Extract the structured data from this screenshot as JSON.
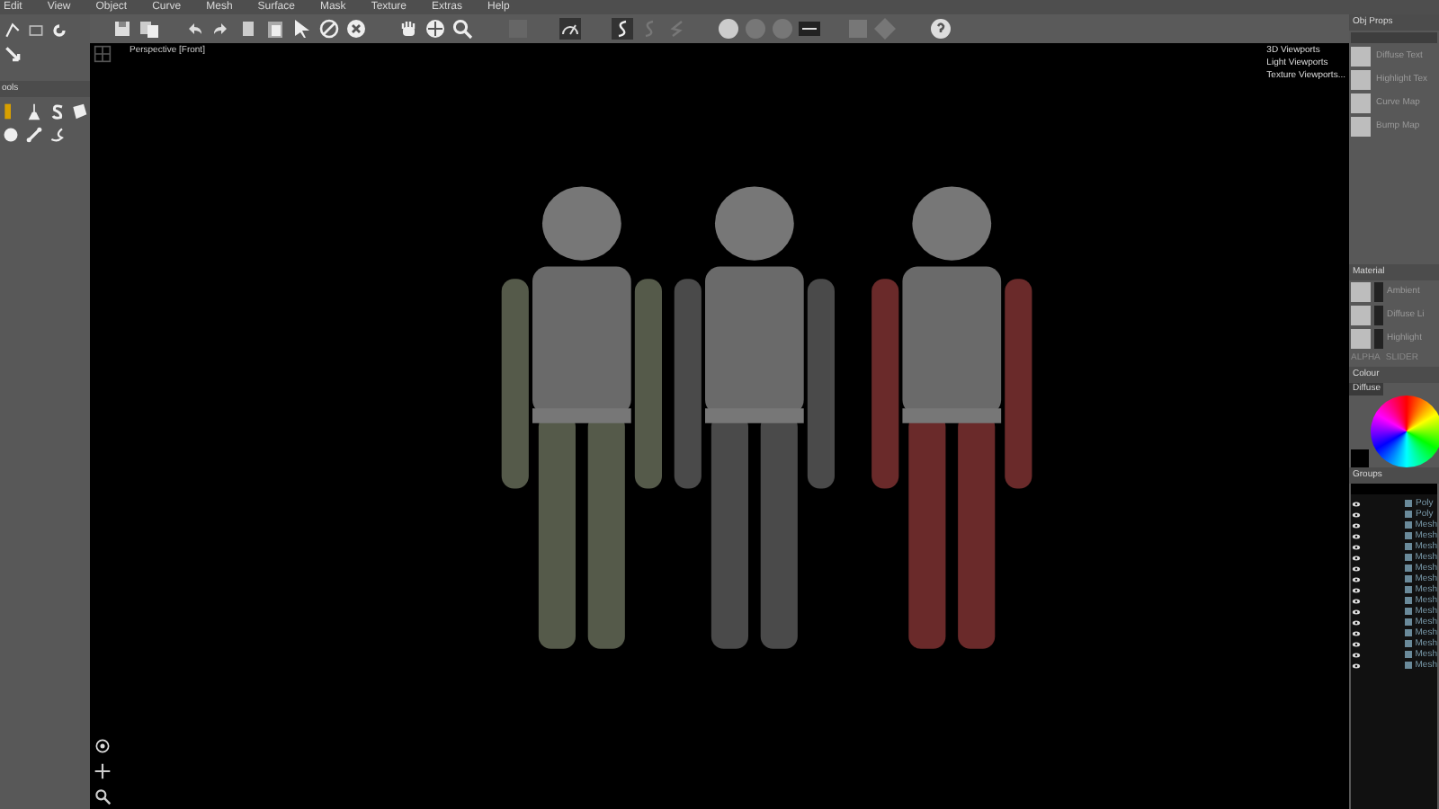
{
  "menu": [
    "Edit",
    "View",
    "Object",
    "Curve",
    "Mesh",
    "Surface",
    "Mask",
    "Texture",
    "Extras",
    "Help"
  ],
  "tools_panel": {
    "title": "ools"
  },
  "viewport": {
    "label": "Perspective [Front]",
    "menu": [
      "3D Viewports",
      "Light Viewports",
      "Texture Viewports..."
    ]
  },
  "obj_props": {
    "title": "Obj Props",
    "maps": [
      "Diffuse Text",
      "Highlight Tex",
      "Curve Map",
      "Bump Map"
    ]
  },
  "material": {
    "title": "Material",
    "slots": [
      "Ambient",
      "Diffuse Li",
      "Highlight"
    ],
    "tabs": [
      "ALPHA",
      "SLIDER"
    ]
  },
  "colour": {
    "title": "Colour",
    "label": "Diffuse"
  },
  "groups": {
    "title": "Groups",
    "rows": [
      "Poly",
      "Poly",
      "Mesh",
      "Mesh",
      "Mesh",
      "Mesh",
      "Mesh",
      "Mesh",
      "Mesh",
      "Mesh",
      "Mesh",
      "Mesh",
      "Mesh",
      "Mesh",
      "Mesh",
      "Mesh"
    ]
  }
}
